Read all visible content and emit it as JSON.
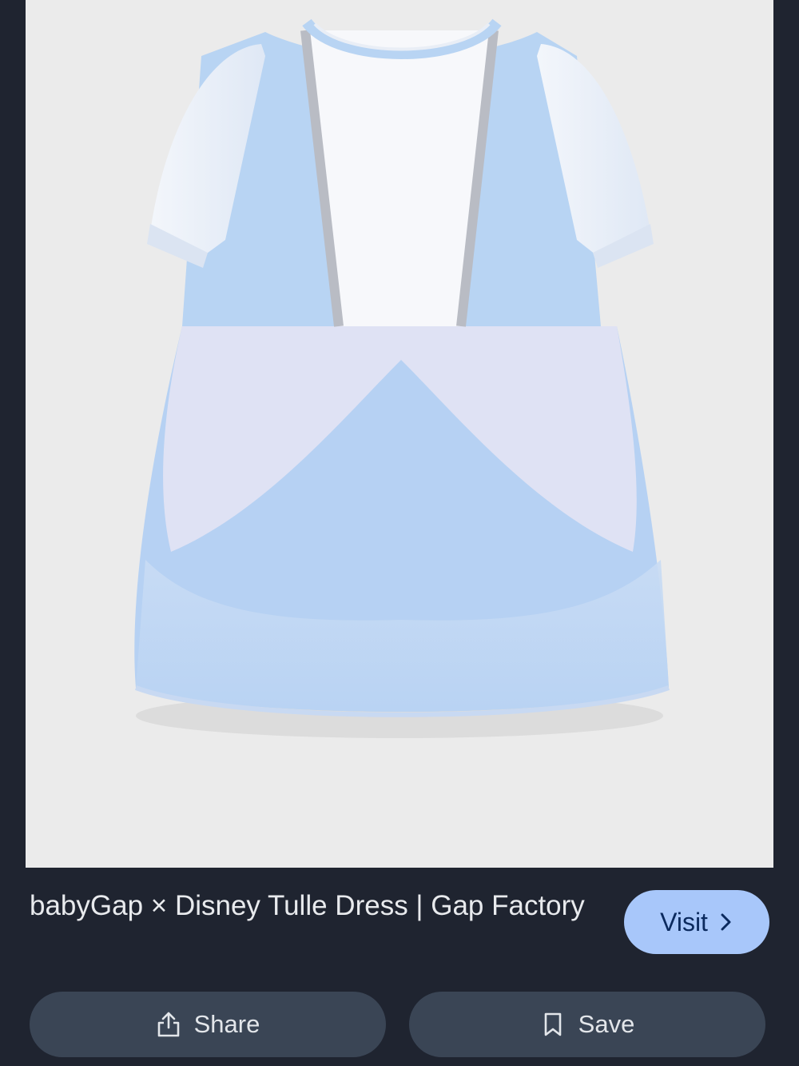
{
  "result": {
    "title": "babyGap × Disney Tulle Dress | Gap Factory",
    "image_alt": "Light blue tulle dress with white puff sleeves"
  },
  "actions": {
    "visit_label": "Visit",
    "share_label": "Share",
    "save_label": "Save"
  },
  "icons": {
    "visit": "chevron-right-icon",
    "share": "share-icon",
    "save": "bookmark-icon"
  },
  "colors": {
    "background": "#1f2430",
    "visit_button": "#a8c7fa",
    "action_button": "#3a4555",
    "dress_blue": "#b7d3f2"
  }
}
